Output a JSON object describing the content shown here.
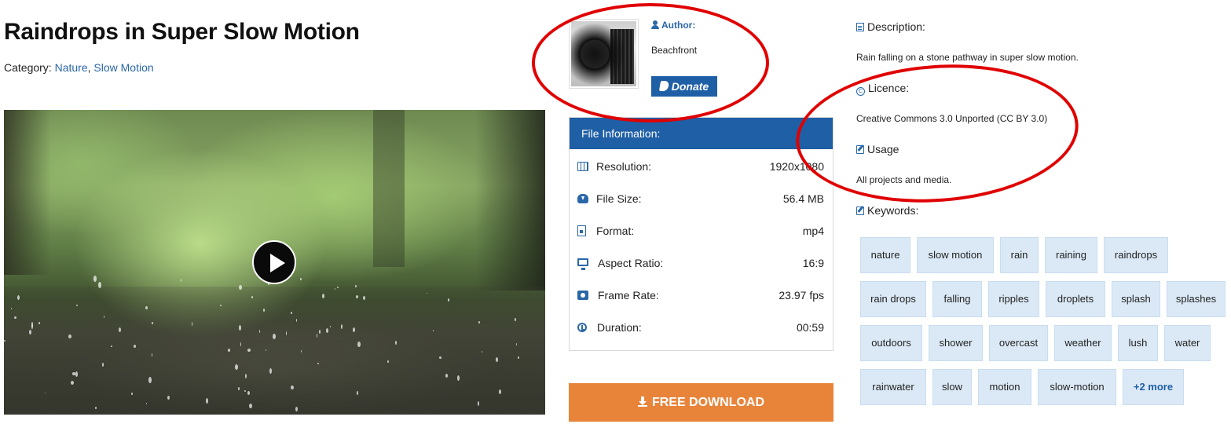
{
  "page": {
    "title": "Raindrops in Super Slow Motion",
    "category_label": "Category:",
    "categories": [
      "Nature",
      "Slow Motion"
    ],
    "category_separator": ","
  },
  "video": {
    "play_icon": "play-icon"
  },
  "author": {
    "label": "Author:",
    "name": "Beachfront",
    "donate_label": "Donate",
    "icons": {
      "user": "user-icon",
      "paypal": "paypal-icon"
    }
  },
  "file_info": {
    "header": "File Information:",
    "rows": [
      {
        "label": "Resolution:",
        "value": "1920x1080",
        "icon": "film-icon"
      },
      {
        "label": "File Size:",
        "value": "56.4 MB",
        "icon": "cloud-download-icon"
      },
      {
        "label": "Format:",
        "value": "mp4",
        "icon": "file-video-icon"
      },
      {
        "label": "Aspect Ratio:",
        "value": "16:9",
        "icon": "monitor-icon"
      },
      {
        "label": "Frame Rate:",
        "value": "23.97 fps",
        "icon": "camera-icon"
      },
      {
        "label": "Duration:",
        "value": "00:59",
        "icon": "clock-icon"
      }
    ]
  },
  "download": {
    "label": "FREE DOWNLOAD",
    "icon": "download-icon"
  },
  "description": {
    "heading": "Description:",
    "text": "Rain falling on a stone pathway in super slow motion."
  },
  "licence": {
    "heading": "Licence:",
    "text": "Creative Commons 3.0 Unported (CC BY 3.0)",
    "icon_glyph": "C"
  },
  "usage": {
    "heading": "Usage",
    "text": "All projects and media."
  },
  "keywords": {
    "heading": "Keywords:",
    "items": [
      "nature",
      "slow motion",
      "rain",
      "raining",
      "raindrops",
      "rain drops",
      "falling",
      "ripples",
      "droplets",
      "splash",
      "splashes",
      "outdoors",
      "shower",
      "overcast",
      "weather",
      "lush",
      "water",
      "rainwater",
      "slow",
      "motion",
      "slow-motion"
    ],
    "more_label": "+2 more"
  },
  "colors": {
    "primary_blue": "#1f5fa6",
    "link_blue": "#2a67a8",
    "download_orange": "#e8843a",
    "keyword_bg": "#dbe9f6",
    "annotation_red": "#e00000"
  }
}
